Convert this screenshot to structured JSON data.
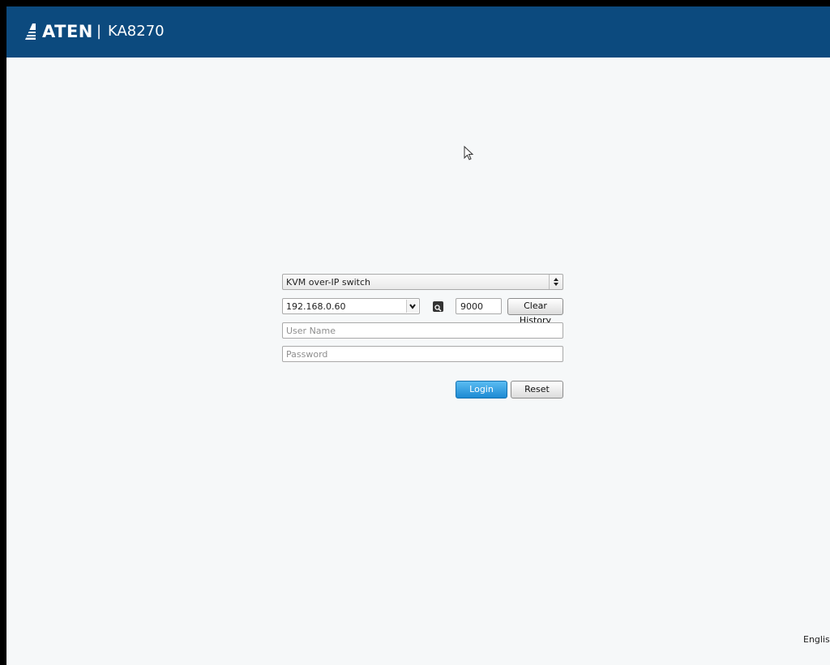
{
  "header": {
    "brand": "ATEN",
    "separator": "|",
    "model": "KA8270",
    "background_color": "#0c4a7e"
  },
  "login_form": {
    "device_type_selected": "KVM over-IP switch",
    "ip_address_value": "192.168.0.60",
    "port_value": "9000",
    "clear_history_label": "Clear History",
    "username_placeholder": "User Name",
    "password_placeholder": "Password",
    "login_label": "Login",
    "reset_label": "Reset",
    "login_button_color": "#1c8ad3"
  },
  "footer": {
    "language": "English"
  },
  "icons": {
    "logo": "aten-logo-icon",
    "search": "search-icon",
    "dropdown": "chevron-down-icon",
    "select_arrows": "up-down-arrows-icon",
    "cursor": "mouse-pointer-icon"
  }
}
